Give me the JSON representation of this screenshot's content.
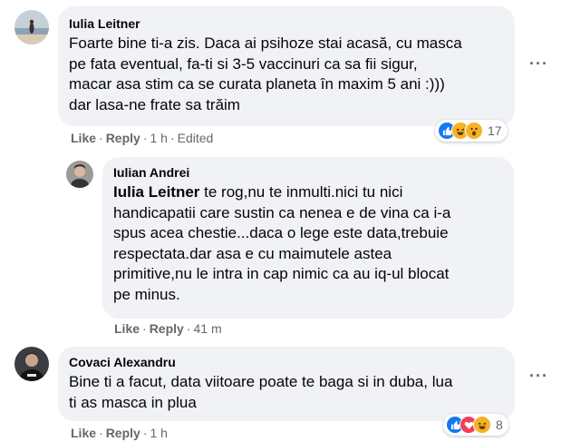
{
  "comments": [
    {
      "author": "Iulia Leitner",
      "text": [
        "Foarte bine ti-a zis. Daca ai psihoze stai acasă, cu masca",
        "pe fata eventual, fa-ti si 3-5 vaccinuri ca sa fii sigur,",
        "macar asa stim ca se curata planeta în maxim 5 ani :)))",
        "dar lasa-ne frate sa trăim"
      ],
      "like_label": "Like",
      "reply_label": "Reply",
      "time": "1 h",
      "edited": "Edited",
      "reaction_count": "17",
      "reactions": [
        "like-icon",
        "haha-icon",
        "wow-icon"
      ]
    },
    {
      "author": "Iulian Andrei",
      "mention": "Iulia Leitner",
      "text": [
        " te rog,nu te inmulti.nici tu nici",
        "handicapatii care sustin ca nenea e de vina ca i-a",
        "spus acea chestie...daca o lege este data,trebuie",
        "respectata.dar asa e cu maimutele astea",
        "primitive,nu le intra in cap nimic ca au iq-ul blocat",
        "pe minus."
      ],
      "like_label": "Like",
      "reply_label": "Reply",
      "time": "41 m"
    },
    {
      "author": "Covaci Alexandru",
      "text": [
        "Bine ti a facut, data viitoare poate te baga si in duba, lua",
        "ti as masca in plua"
      ],
      "like_label": "Like",
      "reply_label": "Reply",
      "time": "1 h",
      "reaction_count": "8",
      "reactions": [
        "like-icon",
        "love-icon",
        "haha-icon"
      ]
    }
  ],
  "more_label": "···",
  "colors": {
    "bubble": "#f0f2f5",
    "meta": "#65676b",
    "like": "#1877f2",
    "love": "#f33e58",
    "haha": "#f7b125"
  }
}
